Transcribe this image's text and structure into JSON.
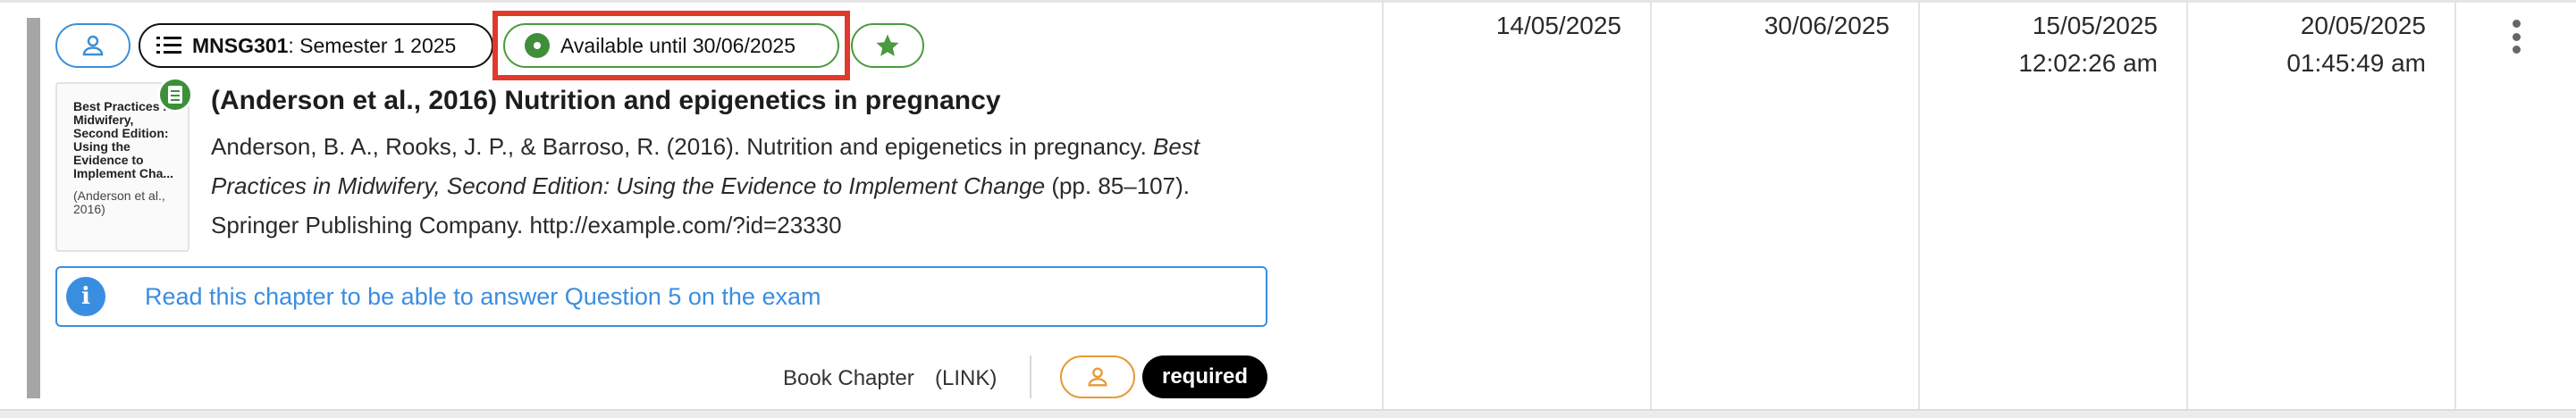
{
  "chips": {
    "module_code": "MNSG301",
    "module_term": ": Semester 1 2025",
    "availability": "Available until 30/06/2025"
  },
  "item": {
    "thumbnail_title": "Best Practices in Midwifery, Second Edition: Using the Evidence to Implement Cha...",
    "thumbnail_cite": "(Anderson et al., 2016)",
    "title": "(Anderson et al., 2016) Nutrition and epigenetics in pregnancy",
    "citation_authors": "Anderson, B. A., Rooks, J. P., & Barroso, R. (2016). Nutrition and epigenetics in pregnancy. ",
    "citation_book": "Best Practices in Midwifery, Second Edition: Using the Evidence to Implement Change",
    "citation_pages": " (pp. 85–107).",
    "citation_publisher": "Springer Publishing Company. http://example.com/?id=23330",
    "note": "Read this chapter to be able to answer Question 5 on the exam",
    "type": "Book Chapter",
    "link_label": "(LINK)",
    "importance": "required"
  },
  "columns": {
    "date_1": "14/05/2025",
    "date_2": "30/06/2025",
    "date_3": "15/05/2025",
    "time_3": "12:02:26 am",
    "date_4": "20/05/2025",
    "time_4": "01:45:49 am"
  },
  "colors": {
    "accent_blue": "#3a8ee0",
    "available_green": "#4a9a3f",
    "highlight_red": "#e03a2b",
    "owner_orange": "#e89a35"
  },
  "icons": {
    "user_chip": "user-icon",
    "module_chip": "list-icon",
    "availability_chip": "status-dot-icon",
    "star_chip": "star-icon",
    "thumbnail_badge": "document-icon",
    "notice": "info-icon",
    "owner_chip": "user-icon",
    "row_menu": "more-vertical-icon"
  }
}
